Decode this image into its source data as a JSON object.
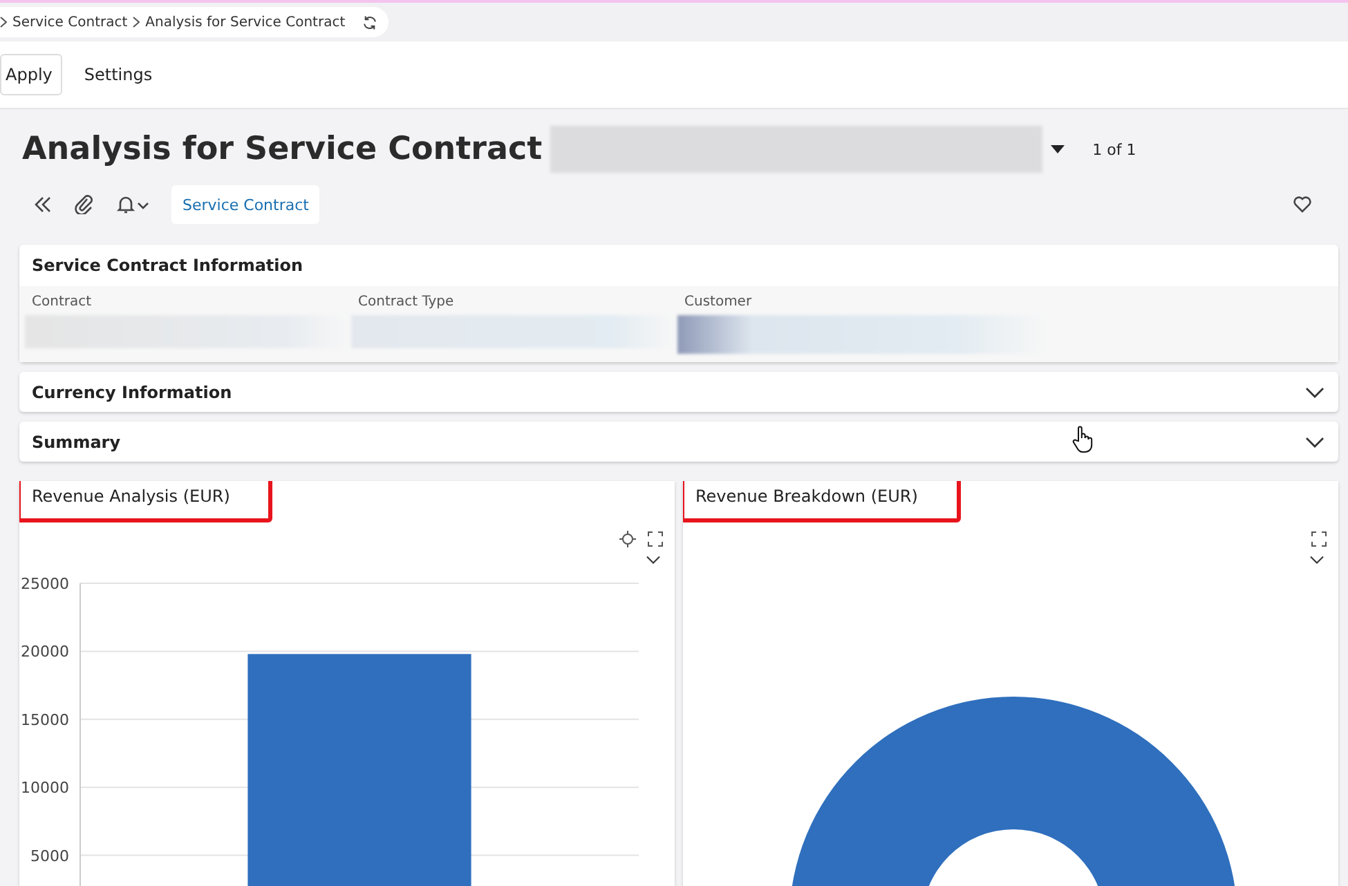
{
  "breadcrumb": [
    {
      "label": "Service Contract"
    },
    {
      "label": "Analysis for Service Contract"
    }
  ],
  "toolbar": {
    "buttons": [
      "Apply",
      "Settings"
    ]
  },
  "header": {
    "title": "Analysis for Service Contract",
    "record_counter": "1 of 1",
    "link": "Service Contract"
  },
  "info_card": {
    "title": "Service Contract Information",
    "fields": [
      {
        "label": "Contract"
      },
      {
        "label": "Contract Type"
      },
      {
        "label": "Customer"
      }
    ]
  },
  "sections": [
    {
      "title": "Currency Information",
      "expanded": false
    },
    {
      "title": "Summary",
      "expanded": false
    }
  ],
  "charts": [
    {
      "kind": "bar",
      "title": "Revenue Analysis (EUR)",
      "highlighted": true,
      "chart_data": {
        "type": "bar",
        "grid": true,
        "values": [
          19800
        ],
        "ylim": [
          0,
          25000
        ],
        "yticks": [
          5000,
          10000,
          15000,
          20000,
          25000
        ]
      }
    },
    {
      "kind": "donut",
      "title": "Revenue Breakdown (EUR)",
      "highlighted": true
    }
  ]
}
